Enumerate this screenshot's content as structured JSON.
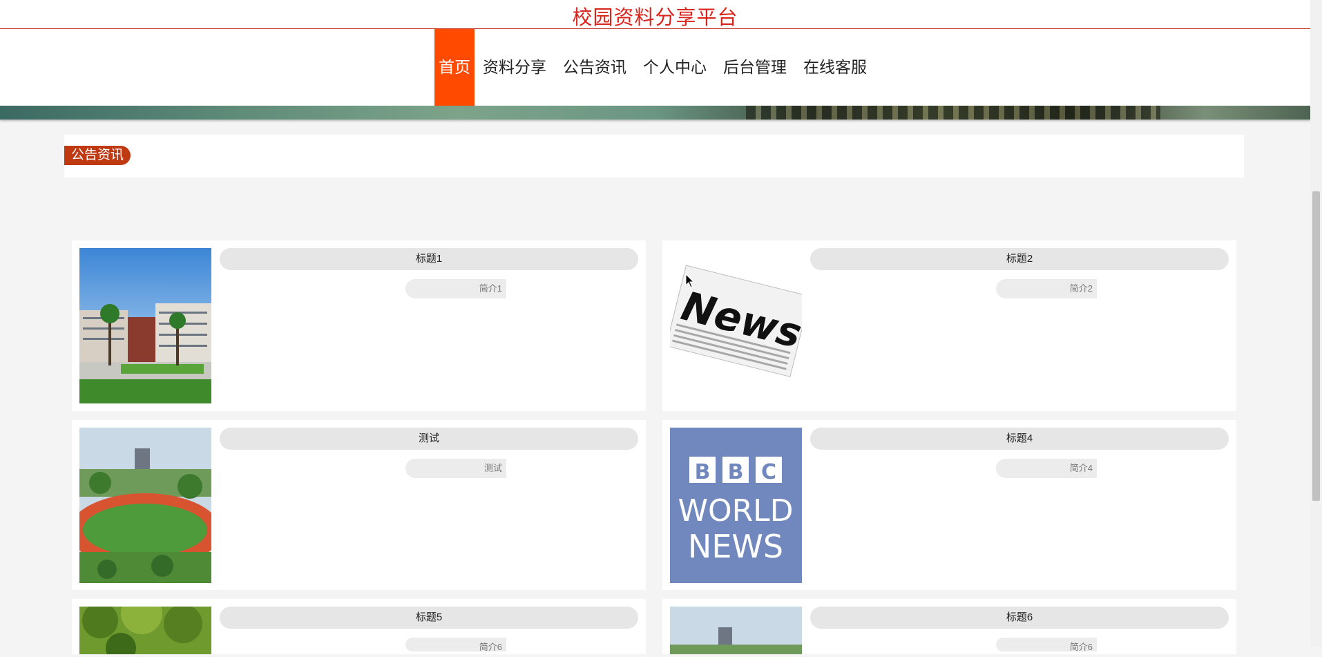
{
  "header": {
    "site_title": "校园资料分享平台"
  },
  "nav": {
    "items": [
      {
        "label": "首页",
        "active": true
      },
      {
        "label": "资料分享",
        "active": false
      },
      {
        "label": "公告资讯",
        "active": false
      },
      {
        "label": "个人中心",
        "active": false
      },
      {
        "label": "后台管理",
        "active": false
      },
      {
        "label": "在线客服",
        "active": false
      }
    ]
  },
  "section": {
    "label": "公告资讯"
  },
  "news": [
    {
      "title": "标题1",
      "intro": "简介1",
      "image": "campus-building"
    },
    {
      "title": "标题2",
      "intro": "简介2",
      "image": "news-newspaper"
    },
    {
      "title": "测试",
      "intro": "测试",
      "image": "campus-sports-field"
    },
    {
      "title": "标题4",
      "intro": "简介4",
      "image": "bbc-world-news"
    },
    {
      "title": "标题5",
      "intro": "简介6",
      "image": "green-trees"
    },
    {
      "title": "标题6",
      "intro": "简介6",
      "image": "campus-landscape"
    }
  ],
  "colors": {
    "accent": "#ff4a00",
    "brand_red": "#d9241c",
    "section_pill": "#bf3a12"
  },
  "thumb_text": {
    "bbc_1": "BBC",
    "bbc_2": "WORLD",
    "bbc_3": "NEWS",
    "news": "News"
  }
}
